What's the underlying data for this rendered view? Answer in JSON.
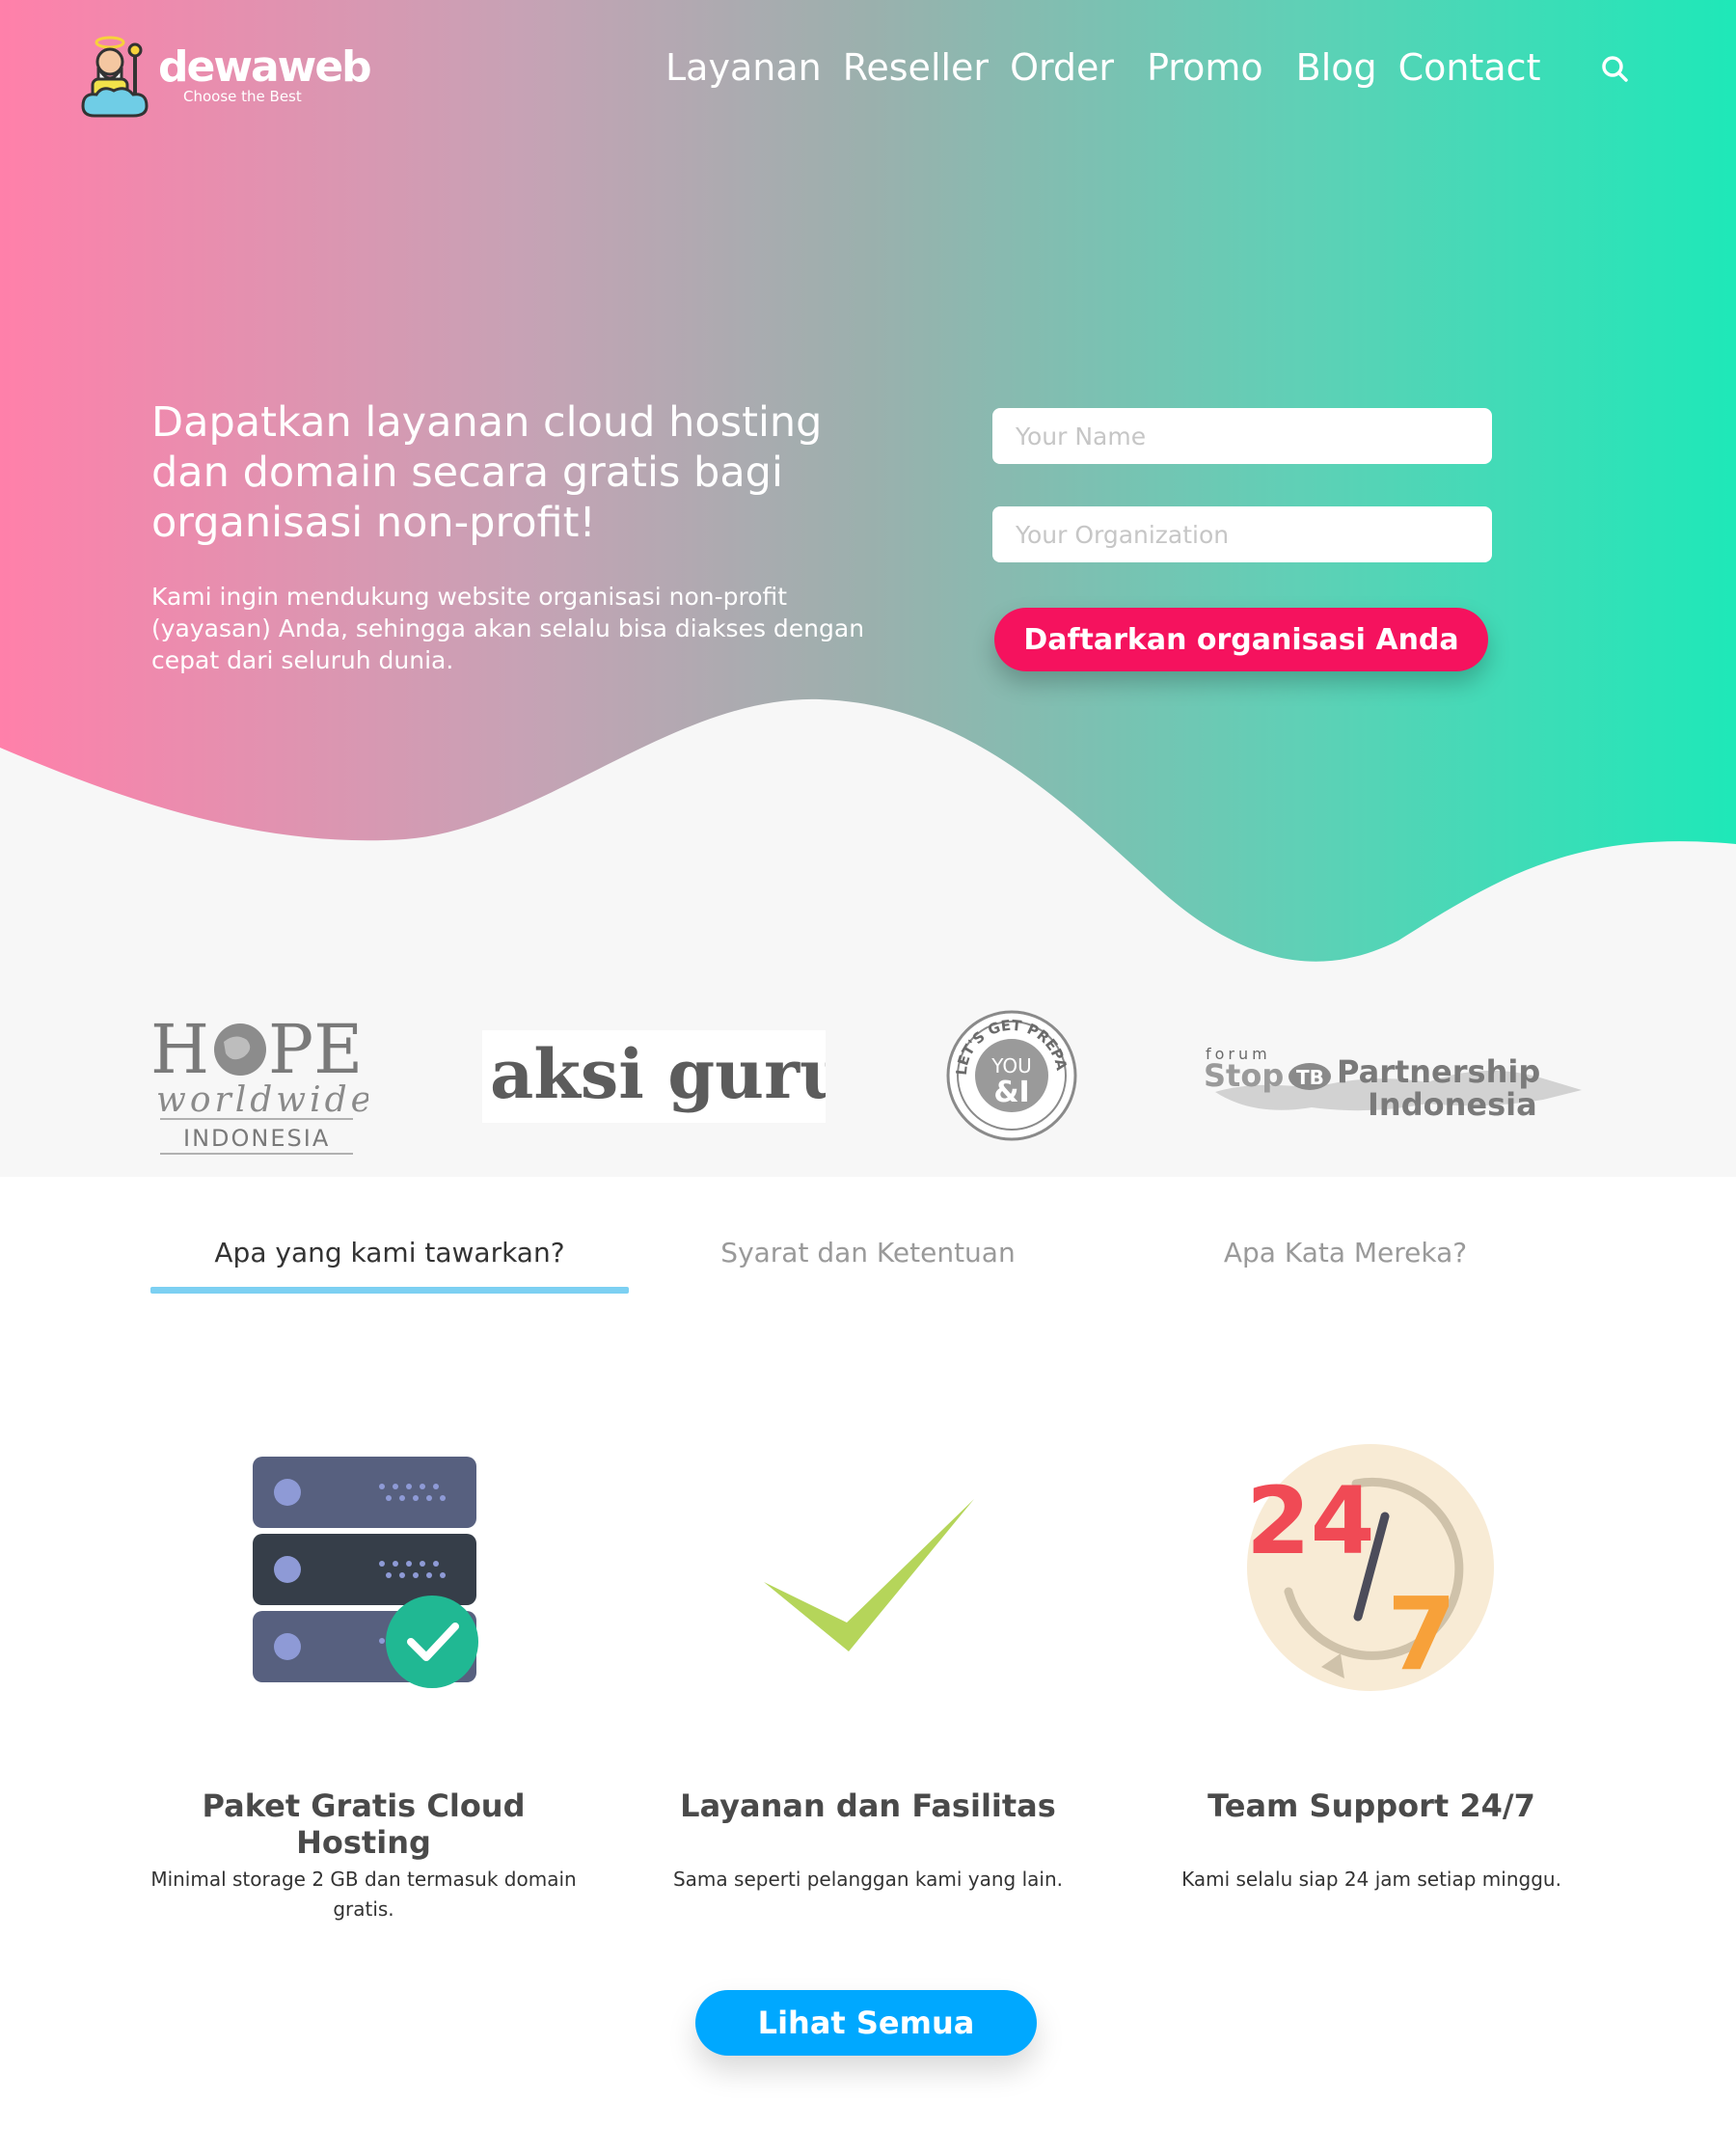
{
  "brand": {
    "name": "dewaweb",
    "tagline": "Choose the Best"
  },
  "nav": {
    "items": [
      {
        "label": "Layanan"
      },
      {
        "label": "Reseller"
      },
      {
        "label": "Order"
      },
      {
        "label": "Promo"
      },
      {
        "label": "Blog"
      },
      {
        "label": "Contact"
      }
    ],
    "search_icon": "search-icon"
  },
  "hero": {
    "title": "Dapatkan layanan cloud hosting dan domain secara gratis bagi organisasi non-profit!",
    "description": "Kami ingin mendukung website organisasi non-profit (yayasan) Anda, sehingga akan selalu bisa diakses dengan cepat dari seluruh dunia.",
    "form": {
      "name_placeholder": "Your Name",
      "name_value": "",
      "org_placeholder": "Your Organization",
      "org_value": "",
      "submit_label": "Daftarkan organisasi Anda"
    }
  },
  "partners": [
    {
      "name": "hope",
      "line1": "H",
      "line1b": "PE",
      "line2": "worldwide",
      "line3": "INDONESIA"
    },
    {
      "name": "aksi-guru",
      "text": "aksi guru"
    },
    {
      "name": "lets-get-prepared",
      "ring": "LET'S GET PREPARED",
      "center1": "YOU",
      "center2": "&I"
    },
    {
      "name": "stop-tb",
      "forum": "forum",
      "stop": "Stop",
      "tb": "TB",
      "partnership": "Partnership",
      "indonesia": "Indonesia"
    }
  ],
  "tabs": [
    {
      "label": "Apa yang kami tawarkan?",
      "active": true
    },
    {
      "label": "Syarat dan Ketentuan",
      "active": false
    },
    {
      "label": "Apa Kata Mereka?",
      "active": false
    }
  ],
  "features": [
    {
      "icon": "server-check-icon",
      "title": "Paket Gratis Cloud Hosting",
      "description": "Minimal storage 2 GB dan termasuk domain gratis."
    },
    {
      "icon": "checkmark-icon",
      "title": "Layanan dan Fasilitas",
      "description": "Sama seperti pelanggan kami yang lain."
    },
    {
      "icon": "support-24-7-icon",
      "title": "Team Support 24/7",
      "description": "Kami selalu siap 24 jam setiap minggu.",
      "icon_text_24": "24",
      "icon_text_7": "7"
    }
  ],
  "more_button": "Lihat Semua",
  "colors": {
    "gradient_start": "#ff80aa",
    "gradient_end": "#1ee8b8",
    "cta": "#f5125e",
    "more_button": "#00a8ff",
    "tab_underline": "#7cd0f2"
  }
}
